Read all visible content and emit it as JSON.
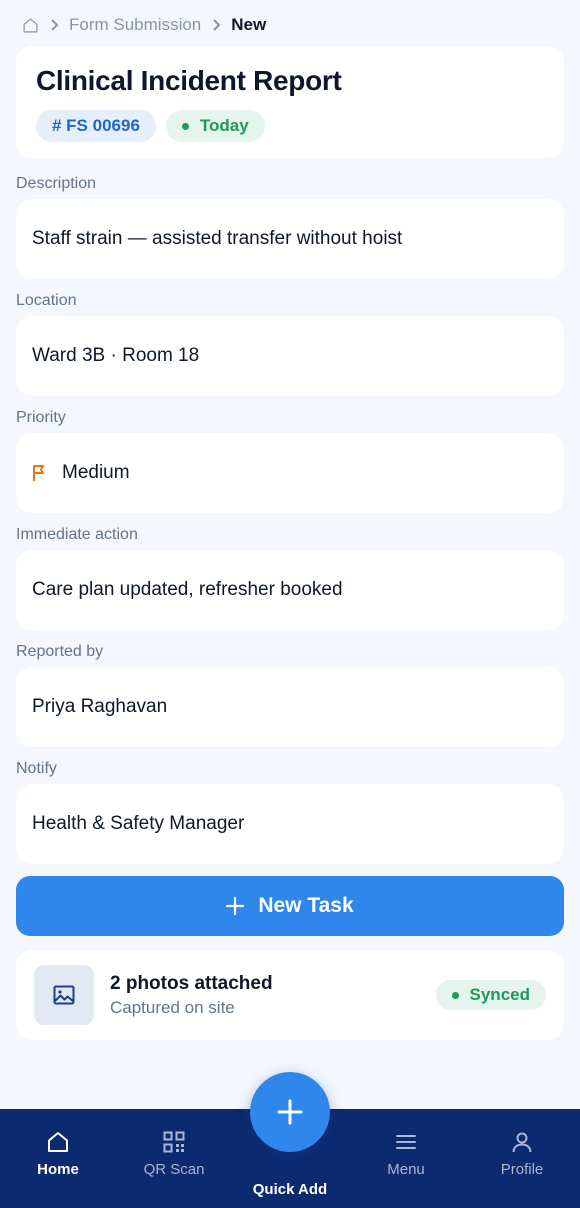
{
  "breadcrumb": {
    "home_icon": "home-icon",
    "parent": "Form Submission",
    "current": "New"
  },
  "header": {
    "title": "Clinical Incident Report",
    "id_badge": "# FS 00696",
    "date_badge": "Today"
  },
  "fields": {
    "description": {
      "label": "Description",
      "value": "Staff strain — assisted transfer without hoist"
    },
    "location": {
      "label": "Location",
      "value": "Ward 3B · Room 18"
    },
    "priority": {
      "label": "Priority",
      "value": "Medium",
      "icon": "flag-icon",
      "icon_color": "#e8771b"
    },
    "immediate_action": {
      "label": "Immediate action",
      "value": "Care plan updated, refresher booked"
    },
    "reported_by": {
      "label": "Reported by",
      "value": "Priya Raghavan"
    },
    "notify": {
      "label": "Notify",
      "value": "Health & Safety Manager"
    }
  },
  "actions": {
    "new_task": "New Task"
  },
  "attachments": {
    "title": "2 photos attached",
    "subtitle": "Captured on site",
    "status": "Synced",
    "icon": "image-icon"
  },
  "nav": {
    "items": [
      {
        "label": "Home",
        "icon": "home-icon",
        "active": true
      },
      {
        "label": "QR Scan",
        "icon": "qr-icon",
        "active": false
      },
      {
        "label": "Menu",
        "icon": "menu-icon",
        "active": false
      },
      {
        "label": "Profile",
        "icon": "user-icon",
        "active": false
      }
    ],
    "quick_add": "Quick Add"
  },
  "colors": {
    "accent": "#2f86eb",
    "nav_bg": "#0b2a6f",
    "success": "#1e9a5d",
    "background": "#f4f7fd"
  }
}
